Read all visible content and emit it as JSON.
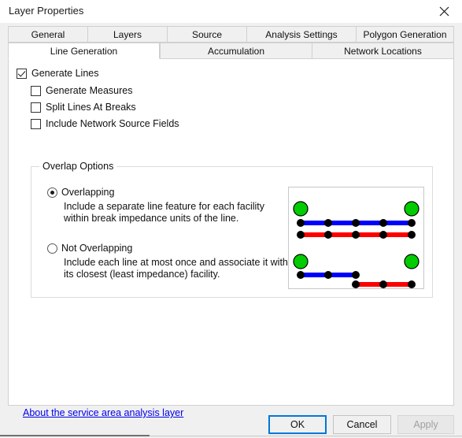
{
  "window": {
    "title": "Layer Properties",
    "close_icon": "close-icon"
  },
  "tabs": {
    "row1": [
      {
        "label": "General",
        "selected": false
      },
      {
        "label": "Layers",
        "selected": false
      },
      {
        "label": "Source",
        "selected": false
      },
      {
        "label": "Analysis Settings",
        "selected": false
      },
      {
        "label": "Polygon Generation",
        "selected": false
      }
    ],
    "row2": [
      {
        "label": "Line Generation",
        "selected": true
      },
      {
        "label": "Accumulation",
        "selected": false
      },
      {
        "label": "Network Locations",
        "selected": false
      }
    ]
  },
  "checkboxes": [
    {
      "label": "Generate Lines",
      "checked": true
    },
    {
      "label": "Generate Measures",
      "checked": false
    },
    {
      "label": "Split Lines At Breaks",
      "checked": false
    },
    {
      "label": "Include Network Source Fields",
      "checked": false
    }
  ],
  "group": {
    "title": "Overlap Options",
    "options": [
      {
        "label": "Overlapping",
        "selected": true,
        "description": "Include a separate line feature for each facility within break impedance units of the line."
      },
      {
        "label": "Not Overlapping",
        "selected": false,
        "description": "Include each line at most once and associate it with its closest (least impedance) facility."
      }
    ]
  },
  "illustration": {
    "name": "overlap-options-diagram",
    "colors": {
      "facility": "#00cc00",
      "line_a": "#0000ff",
      "line_b": "#ff0000",
      "junction": "#000000",
      "outline": "#000000"
    }
  },
  "link": {
    "label": "About the service area analysis layer"
  },
  "buttons": {
    "ok": "OK",
    "cancel": "Cancel",
    "apply": "Apply",
    "apply_enabled": false
  }
}
